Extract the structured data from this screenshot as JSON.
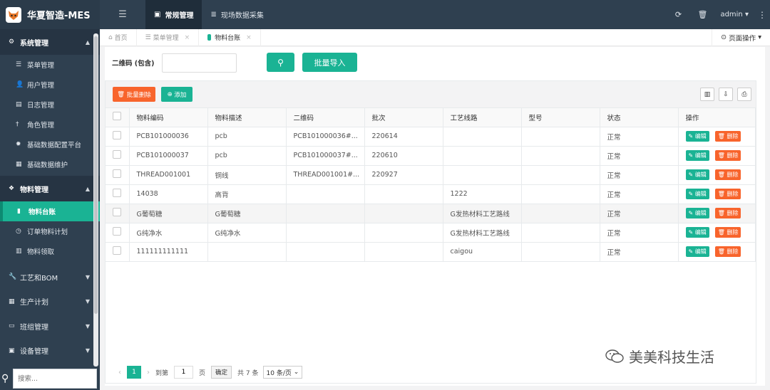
{
  "app": {
    "title": "华夏智造-MES"
  },
  "topbar": {
    "tabs": [
      {
        "label": "常规管理",
        "active": true
      },
      {
        "label": "现场数据采集",
        "active": false
      }
    ],
    "user": "admin"
  },
  "sidebar": {
    "groups": [
      {
        "label": "系统管理",
        "icon": "gears-icon",
        "items": [
          "菜单管理",
          "用户管理",
          "日志管理",
          "角色管理",
          "基础数据配置平台",
          "基础数据维护"
        ]
      },
      {
        "label": "物料管理",
        "icon": "cubes-icon",
        "items": [
          "物料台账",
          "订单物料计划",
          "物料领取"
        ]
      }
    ],
    "closed_groups": [
      "工艺和BOM",
      "生产计划",
      "班组管理",
      "设备管理"
    ],
    "active_item": "物料台账",
    "search_placeholder": "搜索..."
  },
  "tabstrip": {
    "home": "首页",
    "tabs": [
      "菜单管理",
      "物料台账"
    ],
    "page_ops": "页面操作"
  },
  "filter": {
    "label": "二维码 (包含)",
    "value": "",
    "import_button": "批量导入"
  },
  "toolbar": {
    "batch_delete": "批量删除",
    "add": "添加"
  },
  "table": {
    "columns": [
      "物料编码",
      "物料描述",
      "二维码",
      "批次",
      "工艺线路",
      "型号",
      "状态",
      "操作"
    ],
    "rows": [
      [
        "PCB101000036",
        "pcb",
        "PCB101000036#...",
        "220614",
        "",
        "",
        "正常"
      ],
      [
        "PCB101000037",
        "pcb",
        "PCB101000037#...",
        "220610",
        "",
        "",
        "正常"
      ],
      [
        "THREAD001001",
        "铜线",
        "THREAD001001#...",
        "220927",
        "",
        "",
        "正常"
      ],
      [
        "14038",
        "高背",
        "",
        "",
        "1222",
        "",
        "正常"
      ],
      [
        "G葡萄糖",
        "G葡萄糖",
        "",
        "",
        "G发热材料工艺路线",
        "",
        "正常"
      ],
      [
        "G纯净水",
        "G纯净水",
        "",
        "",
        "G发热材料工艺路线",
        "",
        "正常"
      ],
      [
        "111111111111",
        "",
        "",
        "",
        "caigou",
        "",
        "正常"
      ]
    ],
    "edit_label": "编辑",
    "delete_label": "删除"
  },
  "pager": {
    "current": "1",
    "goto_label": "到第",
    "goto_value": "1",
    "page_unit": "页",
    "confirm": "确定",
    "total": "共 7 条",
    "page_size": "10 条/页"
  },
  "watermark": "美美科技生活",
  "colors": {
    "accent": "#1ab394",
    "danger": "#f8642c",
    "sidebar": "#2f4050"
  }
}
